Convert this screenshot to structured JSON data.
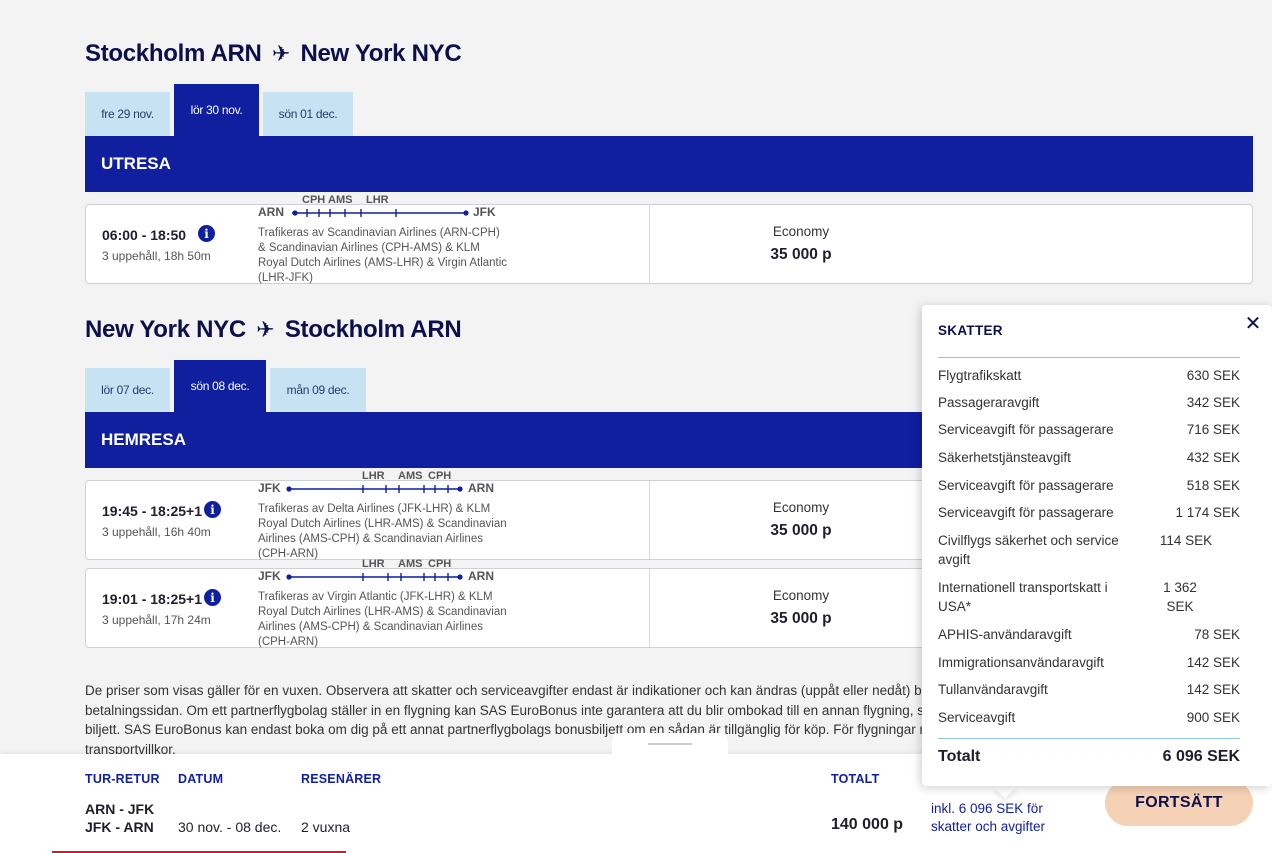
{
  "outbound": {
    "title": {
      "from_city": "Stockholm",
      "from_code": "ARN",
      "to_city": "New York",
      "to_code": "NYC"
    },
    "tabs": [
      "fre 29 nov.",
      "lör 30 nov.",
      "sön 01 dec."
    ],
    "band": "UTRESA",
    "flights": [
      {
        "time": "06:00 - 18:50",
        "stops": "3 uppehåll, 18h 50m",
        "origin": "ARN",
        "dest": "JFK",
        "via": [
          "CPH",
          "AMS",
          "LHR"
        ],
        "operated": "Trafikeras av Scandinavian Airlines (ARN-CPH) & Scandinavian Airlines (CPH-AMS) & KLM Royal Dutch Airlines (AMS-LHR) & Virgin Atlantic (LHR-JFK)",
        "cabin": "Economy",
        "price": "35 000 p"
      }
    ]
  },
  "inbound": {
    "title": {
      "from_city": "New York",
      "from_code": "NYC",
      "to_city": "Stockholm",
      "to_code": "ARN"
    },
    "tabs": [
      "lör 07 dec.",
      "sön 08 dec.",
      "mån 09 dec."
    ],
    "band": "HEMRESA",
    "flights": [
      {
        "time": "19:45 - 18:25+1",
        "stops": "3 uppehåll, 16h 40m",
        "origin": "JFK",
        "dest": "ARN",
        "via": [
          "LHR",
          "AMS",
          "CPH"
        ],
        "operated": "Trafikeras av Delta Airlines (JFK-LHR) & KLM Royal Dutch Airlines (LHR-AMS) & Scandinavian Airlines (AMS-CPH) & Scandinavian Airlines (CPH-ARN)",
        "cabin": "Economy",
        "price": "35 000 p"
      },
      {
        "time": "19:01 - 18:25+1",
        "stops": "3 uppehåll, 17h 24m",
        "origin": "JFK",
        "dest": "ARN",
        "via": [
          "LHR",
          "AMS",
          "CPH"
        ],
        "operated": "Trafikeras av Virgin Atlantic (JFK-LHR) & KLM Royal Dutch Airlines (LHR-AMS) & Scandinavian Airlines (AMS-CPH) & Scandinavian Airlines (CPH-ARN)",
        "cabin": "Economy",
        "price": "35 000 p"
      }
    ]
  },
  "disclaimer": "De priser som visas gäller för en vuxen. Observera att skatter och serviceavgifter endast är indikationer och kan ändras (uppåt eller nedåt) ber betalningssidan. Om ett partnerflygbolag ställer in en flygning kan SAS EuroBonus inte garantera att du blir ombokad till en annan flygning, sa biljett. SAS EuroBonus kan endast boka om dig på ett annat partnerflygbolags bonusbiljett om en sådan är tillgänglig för köp. För flygningar m transportvillkor.",
  "summary": {
    "headers": {
      "trip": "TUR-RETUR",
      "date": "DATUM",
      "pax": "RESENÄRER",
      "total": "TOTALT"
    },
    "trip_line1": "ARN - JFK",
    "trip_line2": "JFK - ARN",
    "date": "30 nov. - 08 dec.",
    "pax": "2 vuxna",
    "total": "140 000 p",
    "incl_line1": "inkl. 6 096 SEK för",
    "incl_line2": "skatter och avgifter",
    "cta": "FORTSÄTT"
  },
  "tax_popup": {
    "title": "SKATTER",
    "rows": [
      {
        "name": "Flygtrafikskatt",
        "value": "630 SEK"
      },
      {
        "name": "Passageraravgift",
        "value": "342 SEK"
      },
      {
        "name": "Serviceavgift för passagerare",
        "value": "716 SEK"
      },
      {
        "name": "Säkerhetstjänsteavgift",
        "value": "432 SEK"
      },
      {
        "name": "Serviceavgift för passagerare",
        "value": "518 SEK"
      },
      {
        "name": "Serviceavgift för passagerare",
        "value": "1 174 SEK"
      },
      {
        "name": "Civilflygs säkerhet och service avgift",
        "value": "114 SEK"
      },
      {
        "name": "Internationell transportskatt i USA*",
        "value": "1 362 SEK"
      },
      {
        "name": "APHIS-användaravgift",
        "value": "78 SEK"
      },
      {
        "name": "Immigrationsanvändaravgift",
        "value": "142 SEK"
      },
      {
        "name": "Tullanvändaravgift",
        "value": "142 SEK"
      },
      {
        "name": "Serviceavgift",
        "value": "900 SEK"
      }
    ],
    "total_label": "Totalt",
    "total_value": "6 096 SEK"
  },
  "colors": {
    "brand": "#0f1f9e",
    "tab_inactive": "#c6e2f3",
    "cta": "#f5d2b5",
    "rule": "#8fc4dd"
  }
}
